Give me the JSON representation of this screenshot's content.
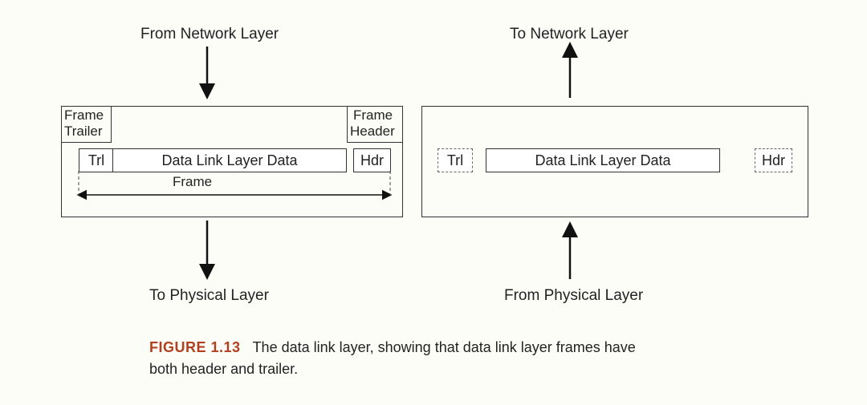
{
  "top": {
    "left_label": "From Network Layer",
    "right_label": "To Network Layer"
  },
  "bottom": {
    "left_label": "To Physical Layer",
    "right_label": "From Physical Layer"
  },
  "left_panel": {
    "frame_trailer_title_l1": "Frame",
    "frame_trailer_title_l2": "Trailer",
    "frame_header_title_l1": "Frame",
    "frame_header_title_l2": "Header",
    "trl": "Trl",
    "data": "Data Link Layer Data",
    "hdr": "Hdr",
    "frame_label": "Frame"
  },
  "right_panel": {
    "trl": "Trl",
    "data": "Data Link Layer Data",
    "hdr": "Hdr"
  },
  "caption": {
    "fig": "FIGURE 1.13",
    "text1": "The data link layer, showing that data link layer frames have",
    "text2": "both header and trailer."
  }
}
